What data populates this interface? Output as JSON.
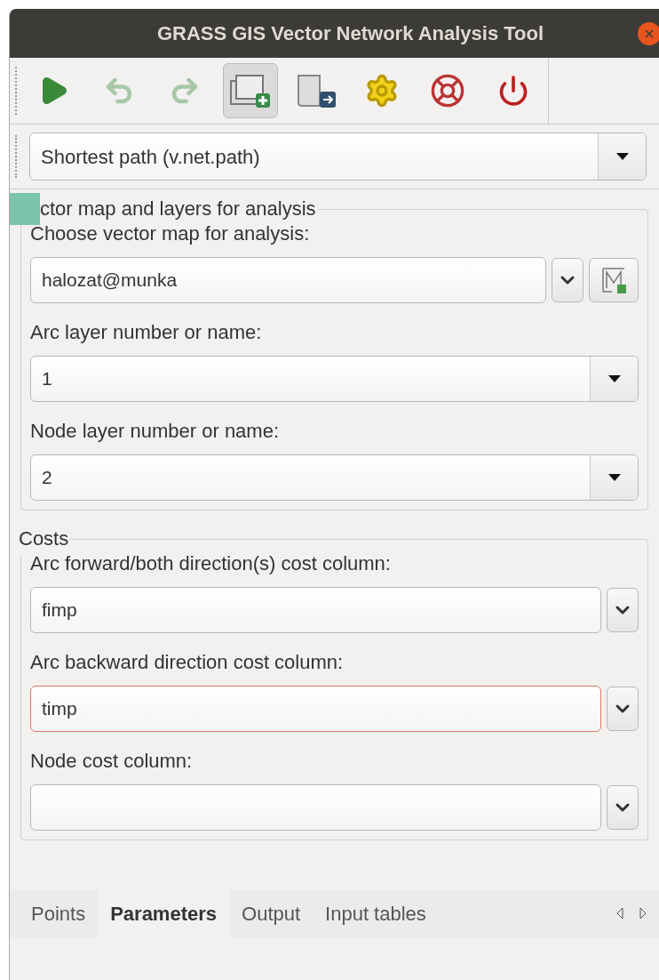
{
  "window": {
    "title": "GRASS GIS Vector Network Analysis Tool"
  },
  "toolbar": [
    {
      "kind": "run",
      "disabled": false,
      "checked": false
    },
    {
      "kind": "undo",
      "disabled": true,
      "checked": false
    },
    {
      "kind": "redo",
      "disabled": true,
      "checked": false
    },
    {
      "kind": "add-layer",
      "disabled": false,
      "checked": true
    },
    {
      "kind": "export",
      "disabled": false,
      "checked": false
    },
    {
      "kind": "settings",
      "disabled": false,
      "checked": false
    },
    {
      "kind": "help",
      "disabled": false,
      "checked": false
    },
    {
      "kind": "quit",
      "disabled": false,
      "checked": false
    }
  ],
  "analysis_select": {
    "value": "Shortest path (v.net.path)"
  },
  "groups": [
    {
      "title": "ctor map and layers for analysis",
      "fields": [
        {
          "label": "Choose vector map for analysis:",
          "kind": "map",
          "value": "halozat@munka",
          "error": false
        },
        {
          "label": "Arc layer number or name:",
          "kind": "select",
          "value": "1",
          "error": false
        },
        {
          "label": "Node layer number or name:",
          "kind": "select",
          "value": "2",
          "error": false
        }
      ]
    },
    {
      "title": "Costs",
      "fields": [
        {
          "label": "Arc forward/both direction(s) cost column:",
          "kind": "combo",
          "value": "fimp",
          "error": false
        },
        {
          "label": "Arc backward direction cost column:",
          "kind": "combo",
          "value": "timp",
          "error": true
        },
        {
          "label": "Node cost column:",
          "kind": "combo",
          "error": false
        }
      ]
    }
  ],
  "tabs": [
    {
      "label": "Points",
      "selected": false
    },
    {
      "label": "Parameters",
      "selected": true
    },
    {
      "label": "Output",
      "selected": false
    },
    {
      "label": "Input tables",
      "selected": false
    }
  ]
}
